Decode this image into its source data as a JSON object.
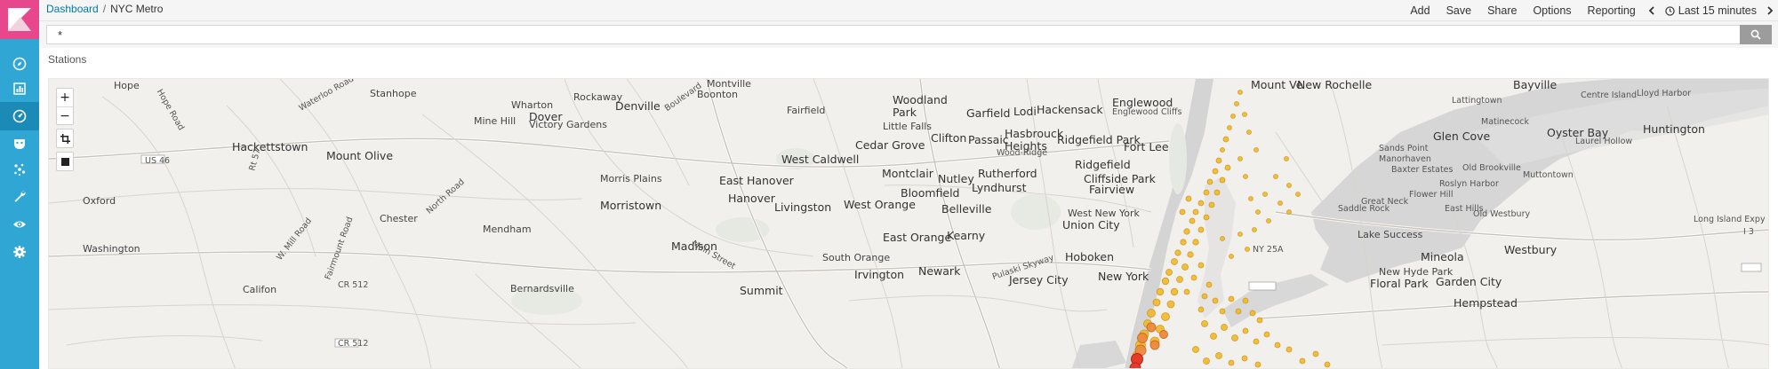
{
  "breadcrumb": {
    "root": "Dashboard",
    "separator": "/",
    "current": "NYC Metro"
  },
  "menu": {
    "add": "Add",
    "save": "Save",
    "share": "Share",
    "options": "Options",
    "reporting": "Reporting"
  },
  "time": {
    "label": "Last 15 minutes"
  },
  "query": {
    "value": "*"
  },
  "panel": {
    "title": "Stations"
  },
  "map": {
    "zoom_in": "+",
    "zoom_out": "−",
    "labels": {
      "hope": "Hope",
      "stanhope": "Stanhope",
      "rockaway": "Rockaway",
      "montville": "Montville",
      "boonton": "Boonton",
      "denville": "Denville",
      "wharton": "Wharton",
      "dover": "Dover",
      "mine_hill": "Mine Hill",
      "victory_gardens": "Victory Gardens",
      "hackettstown": "Hackettstown",
      "mount_olive": "Mount Olive",
      "us46": "US 46",
      "oxford": "Oxford",
      "chester": "Chester",
      "mendham": "Mendham",
      "washington": "Washington",
      "morris_plains": "Morris Plains",
      "morristown": "Morristown",
      "madison": "Madison",
      "califon": "Califon",
      "bernardsville": "Bernardsville",
      "summit": "Summit",
      "cr512": "CR 512",
      "fairfield": "Fairfield",
      "woodland_park": "Woodland\nPark",
      "little_falls": "Little Falls",
      "cedar_grove": "Cedar Grove",
      "west_caldwell": "West Caldwell",
      "east_hanover": "East Hanover",
      "hanover": "Hanover",
      "livingston": "Livingston",
      "west_orange": "West Orange",
      "montclair": "Montclair",
      "nutley": "Nutley",
      "bloomfield": "Bloomfield",
      "belleville": "Belleville",
      "rutherford": "Rutherford",
      "lyndhurst": "Lyndhurst",
      "east_orange": "East Orange",
      "kearny": "Kearny",
      "south_orange": "South Orange",
      "irvington": "Irvington",
      "newark": "Newark",
      "jersey_city": "Jersey City",
      "hoboken": "Hoboken",
      "new_york": "New York",
      "west_new_york": "West New York",
      "union_city": "Union City",
      "garfield": "Garfield",
      "lodi": "Lodi",
      "hackensack": "Hackensack",
      "clifton": "Clifton",
      "passaic": "Passaic",
      "hasbrouck_heights": "Hasbrouck\nHeights",
      "wood_ridge": "Wood-Ridge",
      "ridgefield_park": "Ridgefield Park",
      "ridgefield": "Ridgefield",
      "cliffside_park": "Cliffside Park",
      "fairview": "Fairview",
      "fort_lee": "Fort Lee",
      "englewood": "Englewood",
      "englewood_cliffs": "Englewood Cliffs",
      "mount_vernon": "Mount Ve",
      "new_rochelle": "New Rochelle",
      "sands_point": "Sands Point",
      "manorhaven": "Manorhaven",
      "baxter_estates": "Baxter Estates",
      "glen_cove": "Glen Cove",
      "bayville": "Bayville",
      "centre_island": "Centre Island",
      "lloyd_harbor": "Lloyd Harbor",
      "lattingtown": "Lattingtown",
      "matinecock": "Matinecock",
      "oyster_bay": "Oyster Bay",
      "huntington": "Huntington",
      "laurel_hollow": "Laurel Hollow",
      "old_brookville": "Old Brookville",
      "muttontown": "Muttontown",
      "roslyn_harbor": "Roslyn Harbor",
      "flower_hill": "Flower Hill",
      "great_neck": "Great Neck",
      "saddle_rock": "Saddle Rock",
      "east_hills": "East Hills",
      "old_westbury": "Old Westbury",
      "lake_success": "Lake Success",
      "long_island_expy": "Long Island Expy",
      "i3": "I 3",
      "ny25a": "NY 25A",
      "mineola": "Mineola",
      "westbury": "Westbury",
      "new_hyde_park": "New Hyde Park",
      "floral_park": "Floral Park",
      "garden_city": "Garden City",
      "hempstead": "Hempstead",
      "pulaski_skyway": "Pulaski Skyway",
      "waterloo_road": "Waterloo Road",
      "north_road": "North Road",
      "w_mill_road": "W. Mill Road",
      "fairmount_road": "Fairmount Road",
      "main_street": "Main Street",
      "boulevard": "Boulevard",
      "hope_road": "Hope Road",
      "rt57": "Rt 57"
    }
  }
}
